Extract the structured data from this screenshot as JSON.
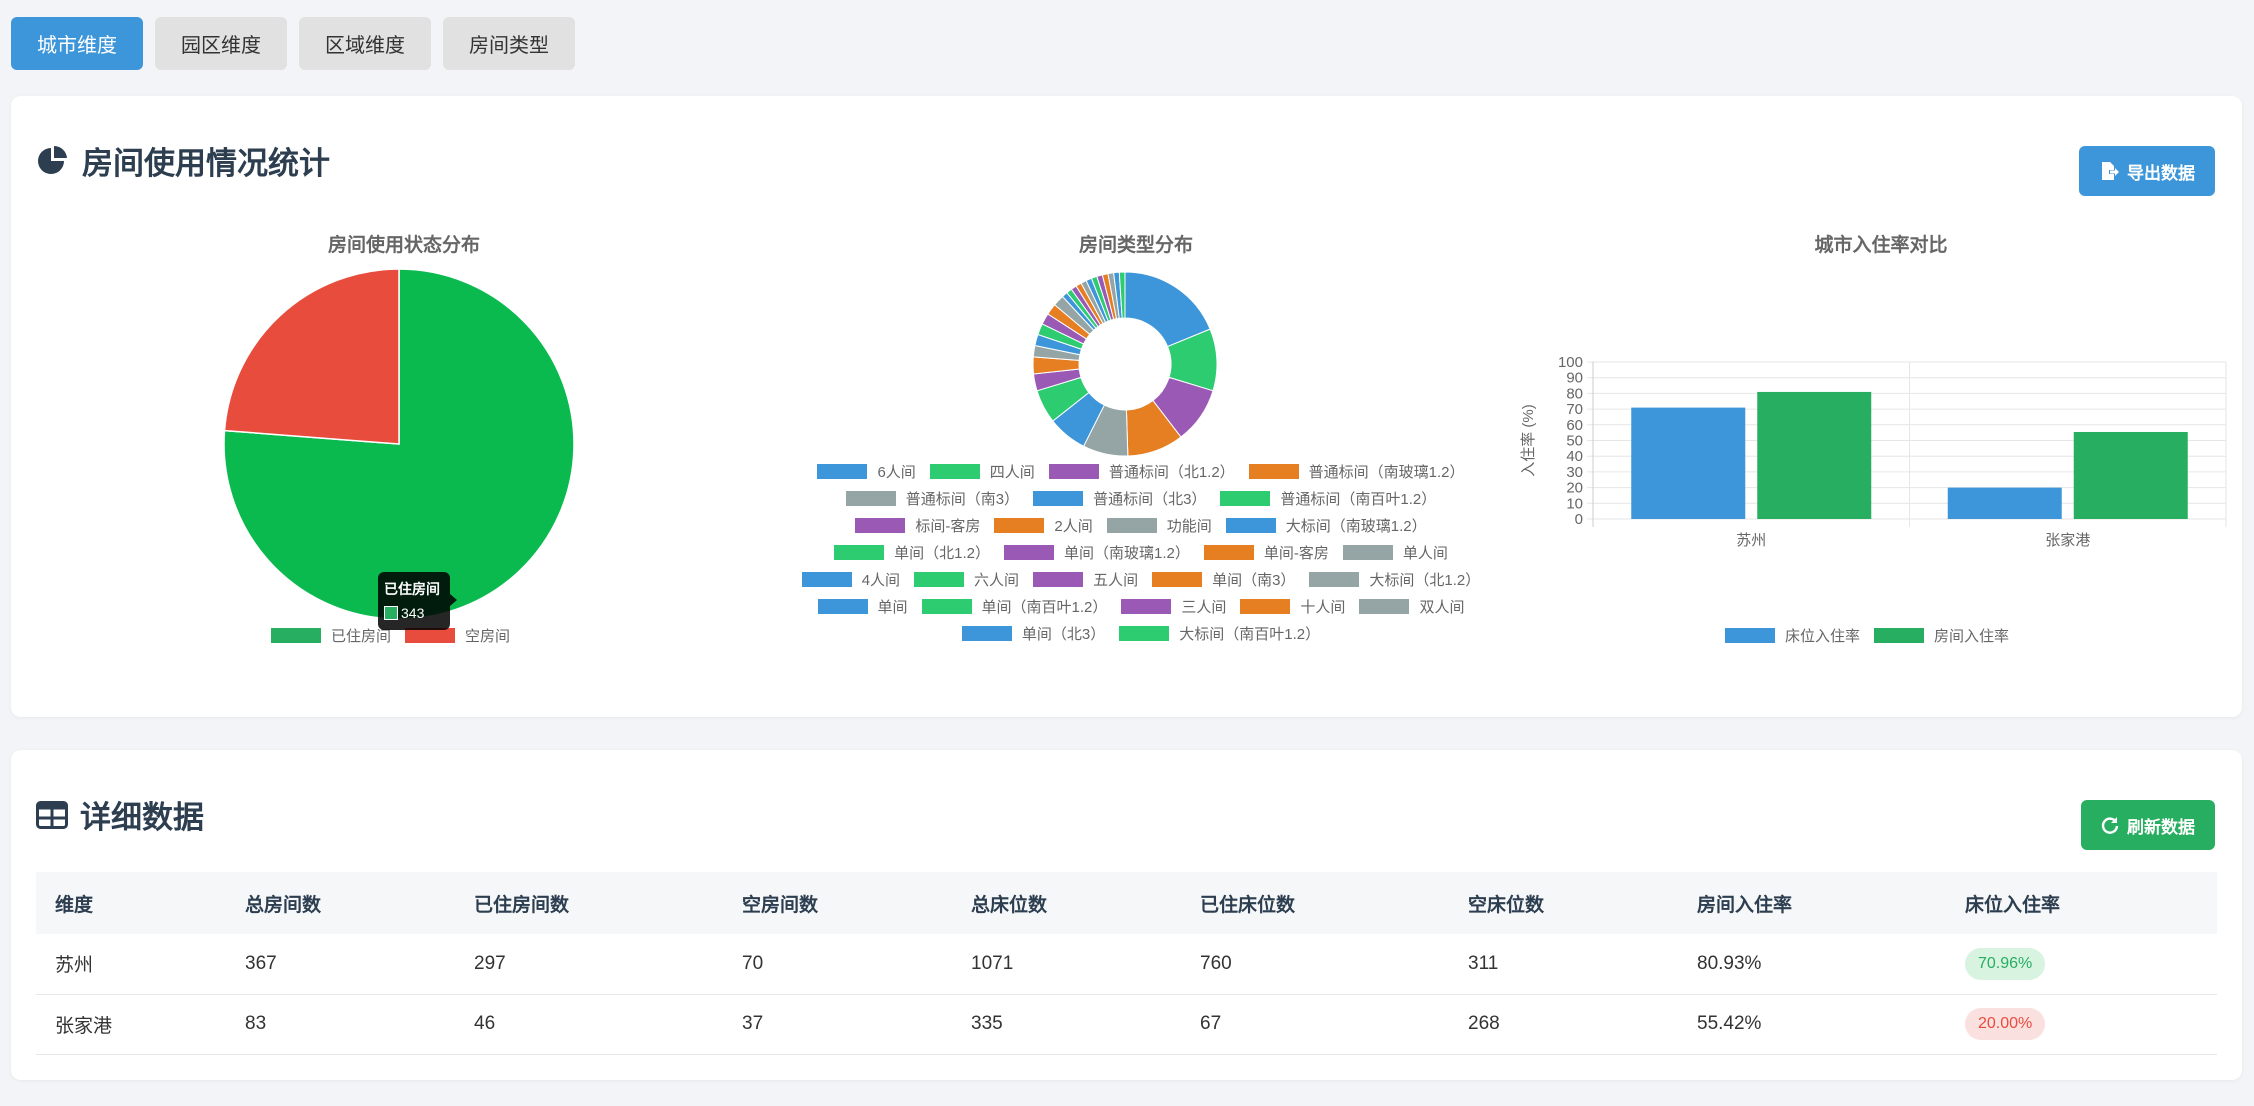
{
  "tabs": [
    {
      "label": "城市维度",
      "active": true
    },
    {
      "label": "园区维度",
      "active": false
    },
    {
      "label": "区域维度",
      "active": false
    },
    {
      "label": "房间类型",
      "active": false
    }
  ],
  "stats_card": {
    "title": "房间使用情况统计",
    "export_label": "导出数据"
  },
  "tooltip": {
    "title": "已住房间",
    "value": "343"
  },
  "detail_card": {
    "title": "详细数据",
    "refresh_label": "刷新数据",
    "columns": [
      "维度",
      "总房间数",
      "已住房间数",
      "空房间数",
      "总床位数",
      "已住床位数",
      "空床位数",
      "房间入住率",
      "床位入住率"
    ],
    "rows": [
      {
        "dim": "苏州",
        "total_rooms": "367",
        "occupied_rooms": "297",
        "empty_rooms": "70",
        "total_beds": "1071",
        "occupied_beds": "760",
        "empty_beds": "311",
        "room_rate": "80.93%",
        "bed_rate": "70.96%",
        "bed_rate_status": "green"
      },
      {
        "dim": "张家港",
        "total_rooms": "83",
        "occupied_rooms": "46",
        "empty_rooms": "37",
        "total_beds": "335",
        "occupied_beds": "67",
        "empty_beds": "268",
        "room_rate": "55.42%",
        "bed_rate": "20.00%",
        "bed_rate_status": "red"
      }
    ]
  },
  "colors": {
    "blue": "#3d96da",
    "green": "#27ae60",
    "pie_green": "#0bba4f",
    "red": "#e74c3c",
    "purple": "#9b59b6",
    "orange": "#e67e22",
    "gray": "#95a5a6",
    "teal": "#2ecc71"
  },
  "chart_data": [
    {
      "type": "pie",
      "title": "房间使用状态分布",
      "labels": [
        "已住房间",
        "空房间"
      ],
      "values": [
        343,
        107
      ],
      "colors": [
        "#0bba4f",
        "#e74c3c"
      ],
      "legend_colors": [
        "#27ae60",
        "#e74c3c"
      ]
    },
    {
      "type": "pie",
      "title": "房间类型分布",
      "labels": [
        "6人间",
        "四人间",
        "普通标间（北1.2）",
        "普通标间（南玻璃1.2）",
        "普通标间（南3）",
        "普通标间（北3）",
        "普通标间（南百叶1.2）",
        "标间-客房",
        "2人间",
        "功能间",
        "大标间（南玻璃1.2）",
        "单间（北1.2）",
        "单间（南玻璃1.2）",
        "单间-客房",
        "单人间",
        "4人间",
        "六人间",
        "五人间",
        "单间（南3）",
        "大标间（北1.2）",
        "单间",
        "单间（南百叶1.2）",
        "三人间",
        "十人间",
        "双人间",
        "单间（北3）",
        "大标间（南百叶1.2）"
      ],
      "values": [
        19,
        11,
        10,
        10,
        8,
        7,
        6,
        3,
        3,
        2,
        2,
        2,
        2,
        2,
        2,
        1,
        1,
        1,
        1,
        1,
        1,
        1,
        1,
        1,
        1,
        1,
        1
      ],
      "colors": [
        "#3d96da",
        "#2ecc71",
        "#9b59b6",
        "#e67e22",
        "#95a5a6"
      ]
    },
    {
      "type": "bar",
      "title": "城市入住率对比",
      "categories": [
        "苏州",
        "张家港"
      ],
      "series": [
        {
          "name": "床位入住率",
          "values": [
            70.96,
            20.0
          ],
          "color": "#3d96da"
        },
        {
          "name": "房间入住率",
          "values": [
            80.93,
            55.42
          ],
          "color": "#27ae60"
        }
      ],
      "ylabel": "入住率 (%)",
      "ylim": [
        0,
        100
      ],
      "yticks": [
        0,
        10,
        20,
        30,
        40,
        50,
        60,
        70,
        80,
        90,
        100
      ]
    }
  ]
}
